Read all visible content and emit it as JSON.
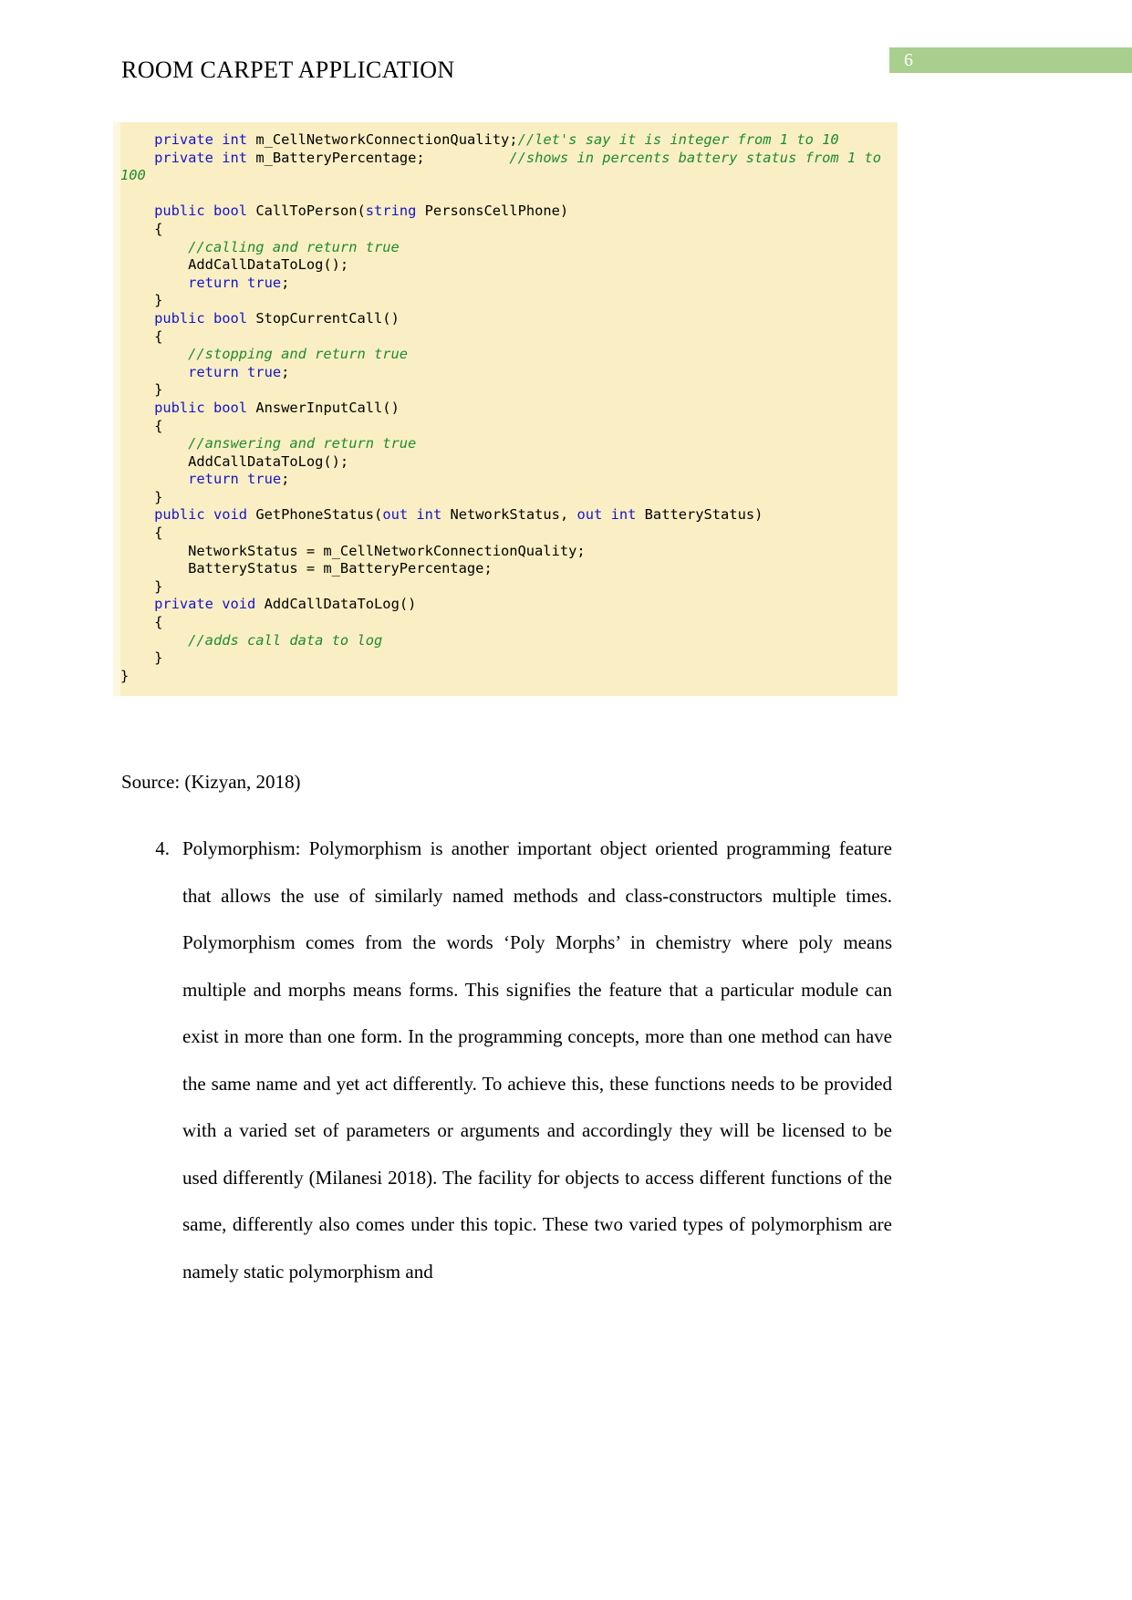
{
  "header": {
    "document_title": "ROOM CARPET APPLICATION",
    "page_number": "6",
    "badge_color": "#a9cf8f"
  },
  "code_block": {
    "background_color": "#faefc4",
    "keyword_color": "#1414cc",
    "comment_color": "#1f8a32",
    "language": "csharp",
    "lines": [
      "    private int m_CellNetworkConnectionQuality;//let's say it is integer from 1 to 10",
      "    private int m_BatteryPercentage;          //shows in percents battery status from 1 to 100",
      "",
      "    public bool CallToPerson(string PersonsCellPhone)",
      "    {",
      "        //calling and return true",
      "        AddCallDataToLog();",
      "        return true;",
      "    }",
      "    public bool StopCurrentCall()",
      "    {",
      "        //stopping and return true",
      "        return true;",
      "    }",
      "    public bool AnswerInputCall()",
      "    {",
      "        //answering and return true",
      "        AddCallDataToLog();",
      "        return true;",
      "    }",
      "    public void GetPhoneStatus(out int NetworkStatus, out int BatteryStatus)",
      "    {",
      "        NetworkStatus = m_CellNetworkConnectionQuality;",
      "        BatteryStatus = m_BatteryPercentage;",
      "    }",
      "    private void AddCallDataToLog()",
      "    {",
      "        //adds call data to log",
      "    }",
      "}"
    ]
  },
  "source_caption": "Source: (Kizyan, 2018)",
  "body_list": {
    "items": [
      {
        "marker": "4.",
        "text": "Polymorphism: Polymorphism is another important object oriented programming feature that allows the use of similarly named methods and class-constructors multiple times. Polymorphism comes from the words ‘Poly Morphs’ in chemistry where poly means multiple and morphs means forms. This signifies the feature that a particular module can exist in more than one form. In the programming concepts, more than one method can have the same name and yet act differently. To achieve this, these functions needs to be provided with a varied set of parameters or arguments and accordingly they will be licensed to be used differently (Milanesi 2018). The facility for objects to access different functions of the same, differently also comes under this topic. These two varied types of polymorphism are namely static polymorphism and"
      }
    ]
  }
}
